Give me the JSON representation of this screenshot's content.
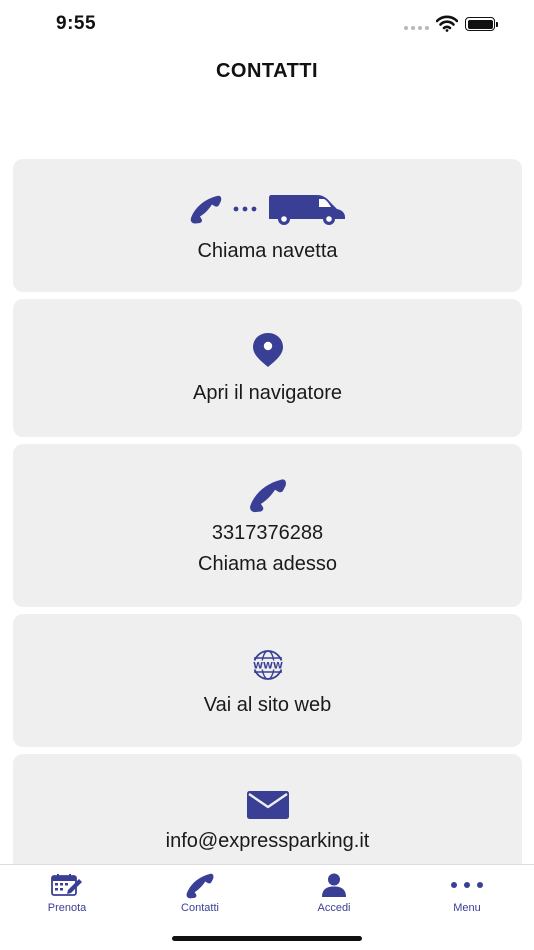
{
  "status_bar": {
    "time": "9:55"
  },
  "header": {
    "title": "CONTATTI"
  },
  "cards": {
    "shuttle": {
      "label": "Chiama navetta",
      "icons": [
        "phone-icon",
        "dots-icon",
        "van-icon"
      ]
    },
    "navigator": {
      "label": "Apri il navigatore",
      "icon": "map-pin-icon"
    },
    "phone": {
      "number": "3317376288",
      "label": "Chiama adesso",
      "icon": "phone-icon"
    },
    "website": {
      "label": "Vai al sito web",
      "icon": "globe-www-icon"
    },
    "email": {
      "address": "info@expressparking.it",
      "icon": "envelope-icon"
    }
  },
  "tab_bar": {
    "items": [
      {
        "label": "Prenota",
        "icon": "calendar-edit-icon"
      },
      {
        "label": "Contatti",
        "icon": "phone-icon"
      },
      {
        "label": "Accedi",
        "icon": "user-icon"
      },
      {
        "label": "Menu",
        "icon": "more-dots-icon"
      }
    ]
  },
  "colors": {
    "accent": "#3a3f96",
    "card_background": "#efefef",
    "text": "#111111"
  }
}
